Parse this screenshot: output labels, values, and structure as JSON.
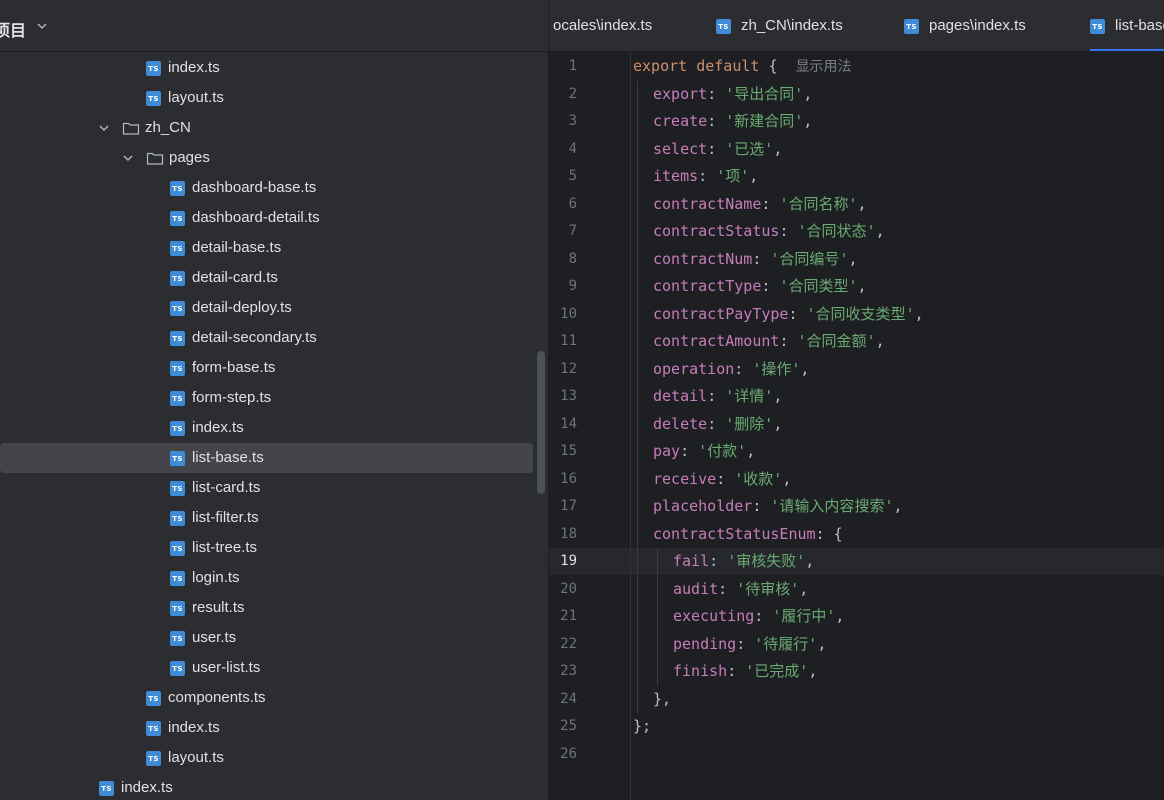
{
  "project_panel": {
    "title": "项目",
    "tree": [
      {
        "label": "index.ts",
        "kind": "ts"
      },
      {
        "label": "layout.ts",
        "kind": "ts"
      },
      {
        "label": "zh_CN",
        "kind": "folder",
        "expanded": true
      },
      {
        "label": "pages",
        "kind": "folder",
        "expanded": true
      },
      {
        "label": "dashboard-base.ts",
        "kind": "ts"
      },
      {
        "label": "dashboard-detail.ts",
        "kind": "ts"
      },
      {
        "label": "detail-base.ts",
        "kind": "ts"
      },
      {
        "label": "detail-card.ts",
        "kind": "ts"
      },
      {
        "label": "detail-deploy.ts",
        "kind": "ts"
      },
      {
        "label": "detail-secondary.ts",
        "kind": "ts"
      },
      {
        "label": "form-base.ts",
        "kind": "ts"
      },
      {
        "label": "form-step.ts",
        "kind": "ts"
      },
      {
        "label": "index.ts",
        "kind": "ts"
      },
      {
        "label": "list-base.ts",
        "kind": "ts",
        "selected": true
      },
      {
        "label": "list-card.ts",
        "kind": "ts"
      },
      {
        "label": "list-filter.ts",
        "kind": "ts"
      },
      {
        "label": "list-tree.ts",
        "kind": "ts"
      },
      {
        "label": "login.ts",
        "kind": "ts"
      },
      {
        "label": "result.ts",
        "kind": "ts"
      },
      {
        "label": "user.ts",
        "kind": "ts"
      },
      {
        "label": "user-list.ts",
        "kind": "ts"
      },
      {
        "label": "components.ts",
        "kind": "ts"
      },
      {
        "label": "index.ts",
        "kind": "ts"
      },
      {
        "label": "layout.ts",
        "kind": "ts"
      },
      {
        "label": "index.ts",
        "kind": "ts"
      }
    ]
  },
  "tabs": [
    {
      "label": "ocales\\index.ts",
      "has_icon": false
    },
    {
      "label": "zh_CN\\index.ts",
      "has_icon": true
    },
    {
      "label": "pages\\index.ts",
      "has_icon": true
    },
    {
      "label": "list-base.ts",
      "has_icon": true,
      "active": true
    }
  ],
  "ts_icon_text": "TS",
  "editor": {
    "current_line": 19,
    "hint": "显示用法",
    "lines": [
      {
        "no": "1",
        "key": "",
        "value": ""
      },
      {
        "no": "2",
        "key": "export",
        "value": "'导出合同'"
      },
      {
        "no": "3",
        "key": "create",
        "value": "'新建合同'"
      },
      {
        "no": "4",
        "key": "select",
        "value": "'已选'"
      },
      {
        "no": "5",
        "key": "items",
        "value": "'项'"
      },
      {
        "no": "6",
        "key": "contractName",
        "value": "'合同名称'"
      },
      {
        "no": "7",
        "key": "contractStatus",
        "value": "'合同状态'"
      },
      {
        "no": "8",
        "key": "contractNum",
        "value": "'合同编号'"
      },
      {
        "no": "9",
        "key": "contractType",
        "value": "'合同类型'"
      },
      {
        "no": "10",
        "key": "contractPayType",
        "value": "'合同收支类型'"
      },
      {
        "no": "11",
        "key": "contractAmount",
        "value": "'合同金额'"
      },
      {
        "no": "12",
        "key": "operation",
        "value": "'操作'"
      },
      {
        "no": "13",
        "key": "detail",
        "value": "'详情'"
      },
      {
        "no": "14",
        "key": "delete",
        "value": "'删除'"
      },
      {
        "no": "15",
        "key": "pay",
        "value": "'付款'"
      },
      {
        "no": "16",
        "key": "receive",
        "value": "'收款'"
      },
      {
        "no": "17",
        "key": "placeholder",
        "value": "'请输入内容搜索'"
      },
      {
        "no": "18",
        "key": "contractStatusEnum",
        "value": ""
      },
      {
        "no": "19",
        "key": "fail",
        "value": "'审核失败'"
      },
      {
        "no": "20",
        "key": "audit",
        "value": "'待审核'"
      },
      {
        "no": "21",
        "key": "executing",
        "value": "'履行中'"
      },
      {
        "no": "22",
        "key": "pending",
        "value": "'待履行'"
      },
      {
        "no": "23",
        "key": "finish",
        "value": "'已完成'"
      },
      {
        "no": "24",
        "key": "",
        "value": ""
      },
      {
        "no": "25",
        "key": "",
        "value": ""
      },
      {
        "no": "26",
        "key": "",
        "value": ""
      }
    ],
    "keyword_export": "export",
    "keyword_default": "default"
  }
}
